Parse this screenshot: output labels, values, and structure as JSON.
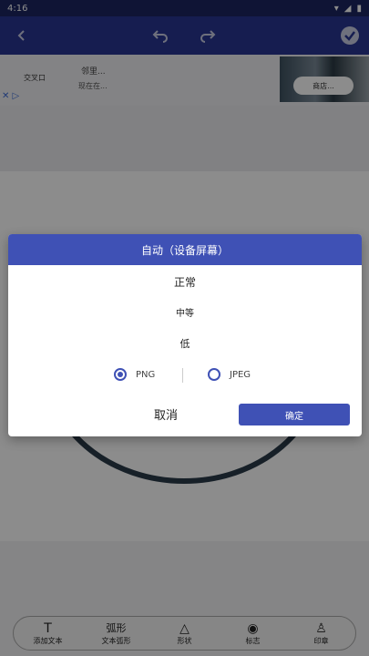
{
  "status": {
    "time": "4:16"
  },
  "ad": {
    "line1": "交叉口",
    "line2": "邻里...",
    "line3": "现在在...",
    "shop": "商店..."
  },
  "dialog": {
    "title": "自动（设备屏幕）",
    "options": [
      "正常",
      "中等",
      "低"
    ],
    "formats": [
      "PNG",
      "JPEG"
    ],
    "selected_format": "PNG",
    "cancel": "取消",
    "confirm": "确定"
  },
  "tools": [
    {
      "icon": "text-icon",
      "label": "添加文本"
    },
    {
      "icon": "arc-text-icon",
      "label": "文本弧形",
      "glyph_text": "弧形"
    },
    {
      "icon": "shapes-icon",
      "label": "形状"
    },
    {
      "icon": "logo-icon",
      "label": "标志"
    },
    {
      "icon": "stamp-icon",
      "label": "印章"
    }
  ]
}
